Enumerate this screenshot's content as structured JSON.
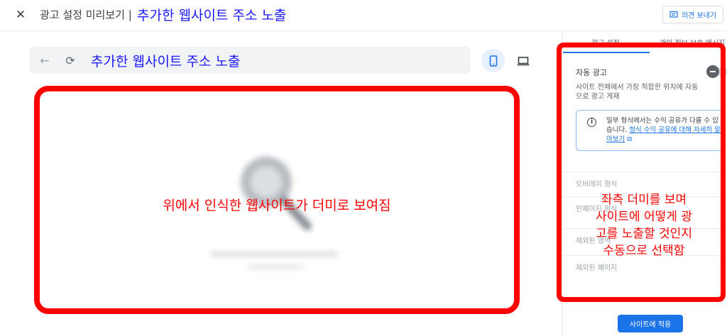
{
  "header": {
    "close_glyph": "✕",
    "title": "광고 설정 미리보기 |",
    "title_annotation": "추가한 웹사이트 주소 노출",
    "feedback_label": "의견 보내기"
  },
  "browser_bar": {
    "back_glyph": "←",
    "refresh_glyph": "⟳",
    "url_annotation": "추가한 웹사이트 주소 노출"
  },
  "preview": {
    "annotation": "위에서 인식한 웹사이트가 더미로 보여짐"
  },
  "panel": {
    "tabs": [
      "광고 설정",
      "개인 정보 보호 메시지"
    ],
    "auto_ads": {
      "title": "자동 광고",
      "description": "사이트 전체에서 가장 적합한 위치에 자동으로 광고 게재"
    },
    "info": {
      "text": "일부 형식에서는 수익 공유가 다를 수 있습니다.",
      "link": "형식 수익 공유에 대해 자세히 알아보기",
      "link_icon": "⧉"
    },
    "rows": [
      {
        "label": "오버레이 형식"
      },
      {
        "label": "인페이지 형식"
      },
      {
        "label": "제외된 영역"
      },
      {
        "label": "제외된 페이지"
      }
    ],
    "apply_label": "사이트에 적용",
    "annotation_lines": [
      "좌측 더미를 보며",
      "사이트에 어떻게 광",
      "고를 노출할 것인지",
      "수동으로 선택함"
    ]
  },
  "colors": {
    "annotation_red": "#ff0000",
    "annotation_blue": "#1a1aff",
    "primary_blue": "#1a73e8"
  }
}
